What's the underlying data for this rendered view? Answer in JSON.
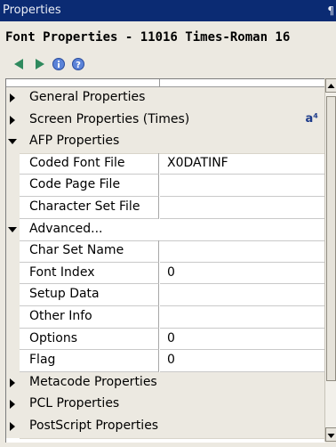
{
  "window": {
    "title": "Properties",
    "pin_glyph": "¶"
  },
  "header": {
    "title": "Font Properties - 11016  Times-Roman 16"
  },
  "toolbar": {
    "icons": [
      "back-arrow-icon",
      "forward-arrow-icon",
      "info-icon",
      "help-icon"
    ]
  },
  "rows": [
    {
      "type": "section",
      "state": "collapsed",
      "label": "General Properties"
    },
    {
      "type": "section",
      "state": "collapsed",
      "label": "Screen Properties (Times)",
      "badge": "a⁴"
    },
    {
      "type": "section",
      "state": "expanded",
      "label": "AFP Properties"
    },
    {
      "type": "prop",
      "name": "Coded Font File",
      "value": "X0DATINF"
    },
    {
      "type": "prop",
      "name": "Code Page File",
      "value": ""
    },
    {
      "type": "prop",
      "name": "Character Set File",
      "value": ""
    },
    {
      "type": "sub",
      "state": "expanded",
      "label": "Advanced..."
    },
    {
      "type": "prop",
      "name": "Char Set Name",
      "value": ""
    },
    {
      "type": "prop",
      "name": "Font Index",
      "value": "0"
    },
    {
      "type": "prop",
      "name": "Setup Data",
      "value": ""
    },
    {
      "type": "prop",
      "name": "Other Info",
      "value": ""
    },
    {
      "type": "prop",
      "name": "Options",
      "value": "0"
    },
    {
      "type": "prop",
      "name": "Flag",
      "value": "0"
    },
    {
      "type": "section",
      "state": "collapsed",
      "label": "Metacode Properties"
    },
    {
      "type": "section",
      "state": "collapsed",
      "label": "PCL Properties"
    },
    {
      "type": "section",
      "state": "collapsed",
      "label": "PostScript Properties"
    }
  ],
  "colors": {
    "titlebar": "#0b2b73",
    "accent_green": "#2e8b57",
    "accent_blue": "#3b67c8"
  }
}
